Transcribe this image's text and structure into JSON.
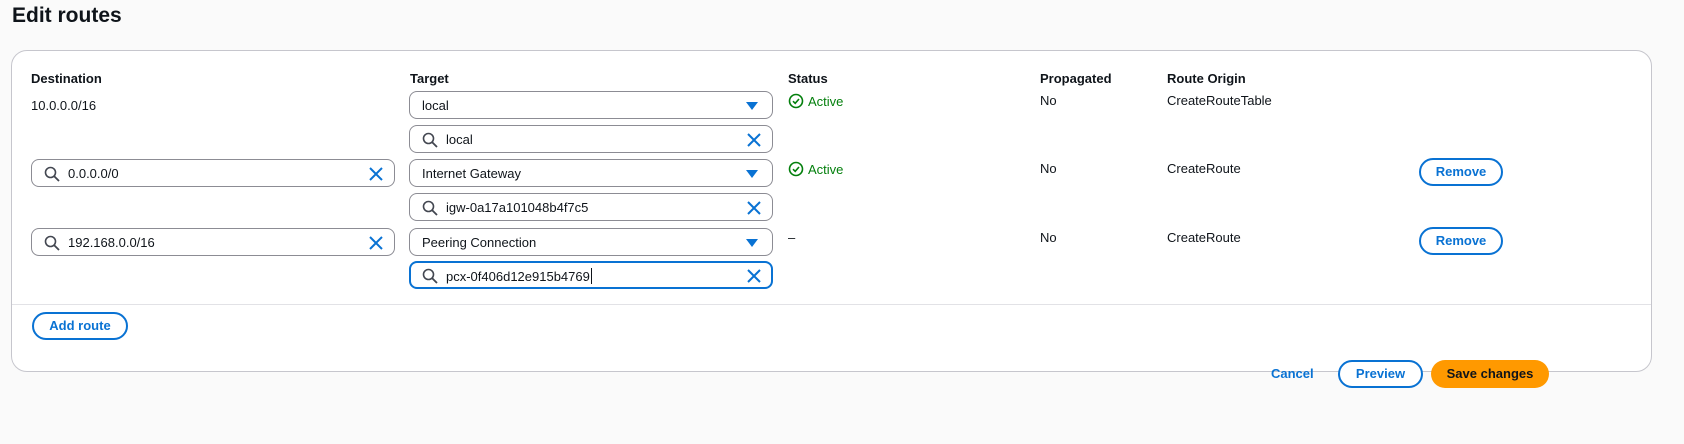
{
  "page": {
    "title": "Edit routes"
  },
  "columns": {
    "destination": "Destination",
    "target": "Target",
    "status": "Status",
    "propagated": "Propagated",
    "route_origin": "Route Origin"
  },
  "routes": [
    {
      "destination": "10.0.0.0/16",
      "target_type": "local",
      "target_value": "local",
      "status": "Active",
      "propagated": "No",
      "route_origin": "CreateRouteTable"
    },
    {
      "destination": "0.0.0.0/0",
      "target_type": "Internet Gateway",
      "target_value": "igw-0a17a101048b4f7c5",
      "status": "Active",
      "propagated": "No",
      "route_origin": "CreateRoute",
      "remove_label": "Remove"
    },
    {
      "destination": "192.168.0.0/16",
      "target_type": "Peering Connection",
      "target_value": "pcx-0f406d12e915b4769",
      "status": "–",
      "propagated": "No",
      "route_origin": "CreateRoute",
      "remove_label": "Remove"
    }
  ],
  "actions": {
    "add_route": "Add route",
    "cancel": "Cancel",
    "preview": "Preview",
    "save": "Save changes"
  },
  "icons": {
    "search": "search-icon",
    "clear": "close-icon",
    "dropdown": "caret-down-icon",
    "status_ok": "status-positive-icon"
  },
  "colors": {
    "accent": "#0972d3",
    "success": "#037f0c",
    "primary_button": "#ff9900",
    "border": "#8c8c94"
  }
}
